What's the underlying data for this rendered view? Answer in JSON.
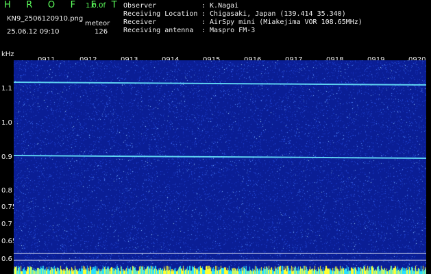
{
  "header": {
    "title": "H R O F F T",
    "version": "1.0.0f",
    "file_name": "KN9_2506120910.png",
    "mode": "meteor",
    "date_time": "25.06.12 09:10",
    "count": "126"
  },
  "info": [
    {
      "label": "Observer",
      "value": ": K.Nagai"
    },
    {
      "label": "Receiving Location",
      "value": ": Chigasaki, Japan (139.414 35.340)"
    },
    {
      "label": "Receiver",
      "value": ": AirSpy mini (Miakejima VOR 108.65MHz)"
    },
    {
      "label": "Receiving antenna",
      "value": ": Maspro FM-3"
    }
  ],
  "y_axis": {
    "unit": "kHz",
    "ticks": [
      "1.1",
      "1.0",
      "0.9",
      "0.8",
      "0.75",
      "0.7",
      "0.65",
      "0.6"
    ]
  },
  "x_axis": {
    "ticks": [
      "0911",
      "0912",
      "0913",
      "0914",
      "0915",
      "0916",
      "0917",
      "0918",
      "0919",
      "0920"
    ]
  },
  "colors": {
    "background": "#0a1e95",
    "signal": "#6df0ff",
    "baseline": "#ffff33",
    "header_green": "#5cff5c",
    "text_white": "#f2f2f2"
  }
}
